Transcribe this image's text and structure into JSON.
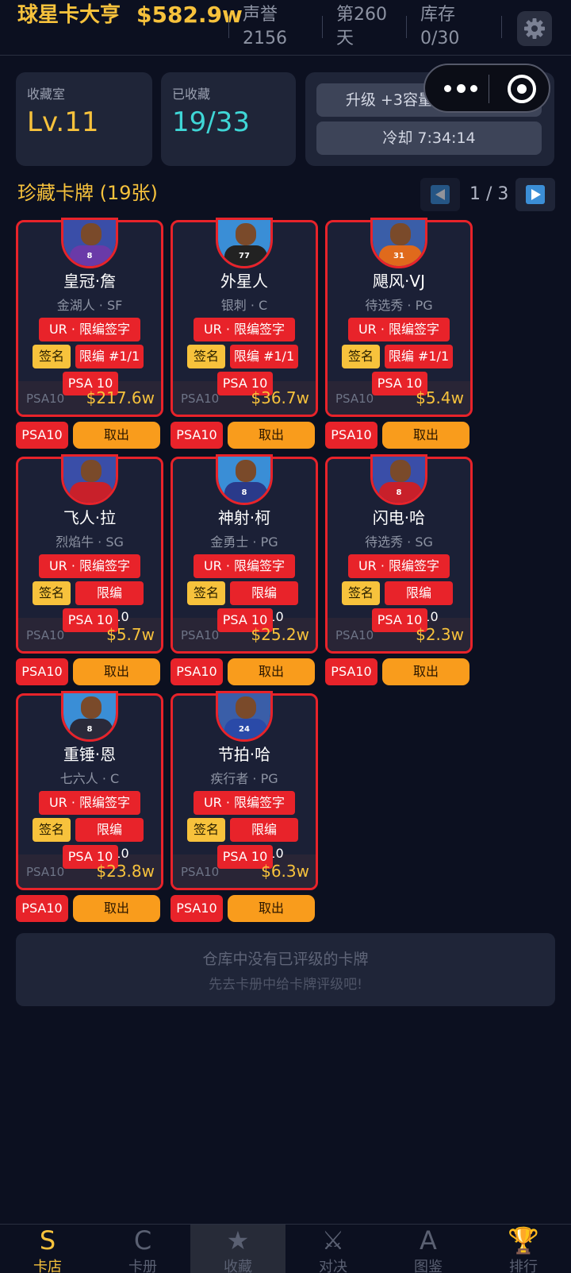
{
  "header": {
    "title": "球星卡大亨",
    "money": "$582.9w",
    "reputation_label": "声誉",
    "reputation_value": "2156",
    "day": "第260天",
    "stock_label": "库存",
    "stock_value": "0/30"
  },
  "info": {
    "room_label": "收藏室",
    "room_level": "Lv.11",
    "collected_label": "已收藏",
    "collected_value": "19/33",
    "upgrade_button": "升级 +3容量 $1000.0w",
    "cooldown_button": "冷却 7:34:14"
  },
  "section": {
    "title": "珍藏卡牌 (19张)",
    "page": "1 / 3"
  },
  "cards": [
    {
      "name": "皇冠·詹",
      "team": "金湖人 · SF",
      "rarity": "UR · 限编签字",
      "sign": "签名",
      "limited": "限编 #1/1",
      "grade": "PSA 10",
      "grade_small": "PSA10",
      "price": "$217.6w",
      "action_grade": "PSA10",
      "action": "取出",
      "jersey": "8",
      "shirt_color": "#6a3aa8",
      "bg_color": "#3a4ea8"
    },
    {
      "name": "外星人",
      "team": "银刺 · C",
      "rarity": "UR · 限编签字",
      "sign": "签名",
      "limited": "限编 #1/1",
      "grade": "PSA 10",
      "grade_small": "PSA10",
      "price": "$36.7w",
      "action_grade": "PSA10",
      "action": "取出",
      "jersey": "77",
      "shirt_color": "#222222",
      "bg_color": "#3a8ed6"
    },
    {
      "name": "飓风·VJ",
      "team": "待选秀 · PG",
      "rarity": "UR · 限编签字",
      "sign": "签名",
      "limited": "限编 #1/1",
      "grade": "PSA 10",
      "grade_small": "PSA10",
      "price": "$5.4w",
      "action_grade": "PSA10",
      "action": "取出",
      "jersey": "31",
      "shirt_color": "#e06a1c",
      "bg_color": "#3a5ea8"
    },
    {
      "name": "飞人·拉",
      "team": "烈焰牛 · SG",
      "rarity": "UR · 限编签字",
      "sign": "签名",
      "limited": "限编 #1/10",
      "grade": "PSA 10",
      "grade_small": "PSA10",
      "price": "$5.7w",
      "action_grade": "PSA10",
      "action": "取出",
      "jersey": "",
      "shirt_color": "#c8202a",
      "bg_color": "#3a4ea8"
    },
    {
      "name": "神射·柯",
      "team": "金勇士 · PG",
      "rarity": "UR · 限编签字",
      "sign": "签名",
      "limited": "限编 #2/10",
      "grade": "PSA 10",
      "grade_small": "PSA10",
      "price": "$25.2w",
      "action_grade": "PSA10",
      "action": "取出",
      "jersey": "8",
      "shirt_color": "#2a3a8a",
      "bg_color": "#3a8ed6"
    },
    {
      "name": "闪电·哈",
      "team": "待选秀 · SG",
      "rarity": "UR · 限编签字",
      "sign": "签名",
      "limited": "限编 #4/10",
      "grade": "PSA 10",
      "grade_small": "PSA10",
      "price": "$2.3w",
      "action_grade": "PSA10",
      "action": "取出",
      "jersey": "8",
      "shirt_color": "#c8202a",
      "bg_color": "#3a4ea8"
    },
    {
      "name": "重锤·恩",
      "team": "七六人 · C",
      "rarity": "UR · 限编签字",
      "sign": "签名",
      "limited": "限编 #5/10",
      "grade": "PSA 10",
      "grade_small": "PSA10",
      "price": "$23.8w",
      "action_grade": "PSA10",
      "action": "取出",
      "jersey": "8",
      "shirt_color": "#2a2a3a",
      "bg_color": "#3a8ed6"
    },
    {
      "name": "节拍·哈",
      "team": "疾行者 · PG",
      "rarity": "UR · 限编签字",
      "sign": "签名",
      "limited": "限编 #9/10",
      "grade": "PSA 10",
      "grade_small": "PSA10",
      "price": "$6.3w",
      "action_grade": "PSA10",
      "action": "取出",
      "jersey": "24",
      "shirt_color": "#2a4aa8",
      "bg_color": "#3a5ea8"
    }
  ],
  "empty": {
    "line1": "仓库中没有已评级的卡牌",
    "line2": "先去卡册中给卡牌评级吧!"
  },
  "nav": [
    {
      "icon": "S",
      "label": "卡店"
    },
    {
      "icon": "C",
      "label": "卡册"
    },
    {
      "icon": "★",
      "label": "收藏"
    },
    {
      "icon": "⚔",
      "label": "对决"
    },
    {
      "icon": "A",
      "label": "图鉴"
    },
    {
      "icon": "🏆",
      "label": "排行"
    }
  ],
  "colors": {
    "accent": "#f7c23c",
    "cyan": "#3fd6d6",
    "red": "#e8232a",
    "orange": "#f99c1c",
    "background": "#0c1020"
  }
}
